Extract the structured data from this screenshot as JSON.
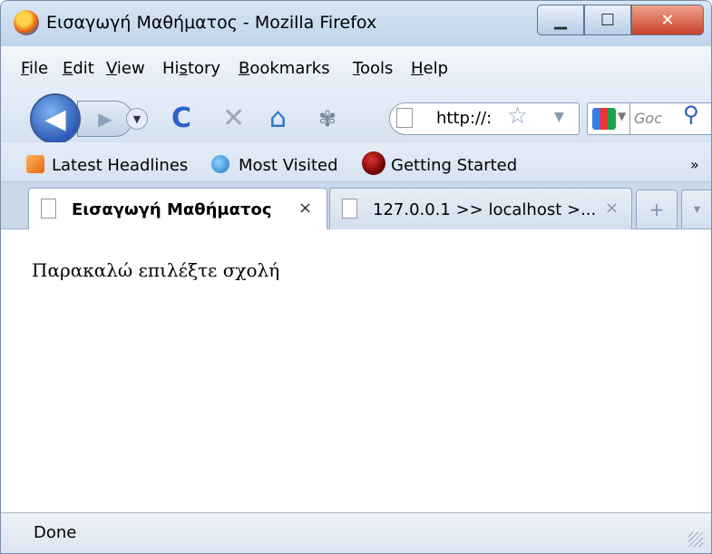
{
  "window": {
    "title": "Εισαγωγή Μαθήματος - Mozilla Firefox",
    "controls": {
      "minimize": "▁",
      "maximize": "☐",
      "close": "✕"
    }
  },
  "menu": [
    {
      "label": "File",
      "mnemonic_index": 0
    },
    {
      "label": "Edit",
      "mnemonic_index": 0
    },
    {
      "label": "View",
      "mnemonic_index": 0
    },
    {
      "label": "History",
      "mnemonic_index": 2
    },
    {
      "label": "Bookmarks",
      "mnemonic_index": 0
    },
    {
      "label": "Tools",
      "mnemonic_index": 0
    },
    {
      "label": "Help",
      "mnemonic_index": 0
    }
  ],
  "nav": {
    "back_glyph": "◀",
    "forward_glyph": "▶",
    "dropdown_glyph": "▼",
    "reload_glyph": "C",
    "stop_glyph": "✕",
    "home_glyph": "⌂",
    "extra_glyph": "✾",
    "url": "http://:",
    "star_glyph": "☆",
    "url_dropdown_glyph": "▼",
    "search_placeholder": "Goc",
    "search_glyph": "⚲"
  },
  "bookmarks": [
    {
      "label": "Latest Headlines",
      "icon": "rss-icon"
    },
    {
      "label": "Most Visited",
      "icon": "ie-icon"
    },
    {
      "label": "Getting Started",
      "icon": "firefox-icon"
    }
  ],
  "bookmarks_overflow": "»",
  "tabs": [
    {
      "label": "Εισαγωγή Μαθήματος",
      "close": "×",
      "active": true
    },
    {
      "label": "127.0.0.1 >> localhost >...",
      "close": "×",
      "active": false
    }
  ],
  "new_tab_glyph": "+",
  "tab_list_glyph": "▾",
  "page": {
    "text": "Παρακαλώ επιλέξτε σχολή"
  },
  "status": {
    "text": "Done"
  },
  "colors": {
    "accent": "#2c5cb7",
    "close_red": "#c9412a",
    "chrome_blue": "#cfdcec"
  }
}
